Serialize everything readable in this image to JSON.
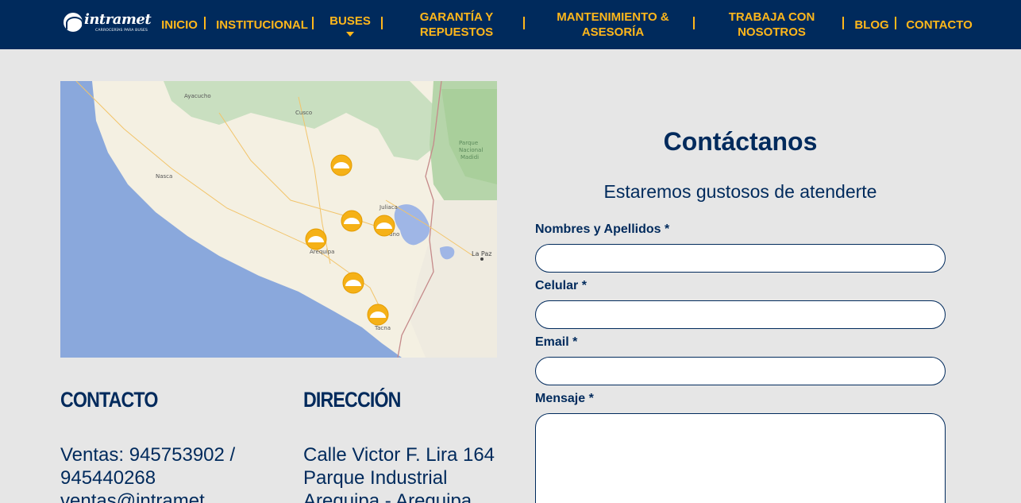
{
  "brand": {
    "name": "intramet",
    "tagline": "CARROCERÍAS PARA BUSES"
  },
  "nav": {
    "items": [
      {
        "label": "INICIO"
      },
      {
        "label": "INSTITUCIONAL"
      },
      {
        "label": "BUSES"
      },
      {
        "label": "GARANTÍA Y REPUESTOS"
      },
      {
        "label": "MANTENIMIENTO & ASESORÍA"
      },
      {
        "label": "TRABAJA CON NOSOTROS"
      },
      {
        "label": "BLOG"
      },
      {
        "label": "CONTACTO"
      }
    ]
  },
  "map": {
    "places": [
      "Ayacucho",
      "Cusco",
      "Nasca",
      "Juliaca",
      "Puno",
      "Arequipa",
      "La Paz",
      "Tacna",
      "Parque Nacional Madidi"
    ],
    "marker_icon": "intramet-logo-marker"
  },
  "contact": {
    "title": "CONTACTO",
    "line1": "Ventas: 945753902 /",
    "line2": "945440268",
    "line3": "ventas@intramet..."
  },
  "address": {
    "title": "DIRECCIÓN",
    "line1": "Calle Victor F. Lira 164",
    "line2": "Parque Industrial",
    "line3": "Arequipa - Arequipa"
  },
  "form": {
    "title": "Contáctanos",
    "subtitle": "Estaremos gustosos de atenderte",
    "name_label": "Nombres y Apellidos *",
    "phone_label": "Celular *",
    "email_label": "Email *",
    "message_label": "Mensaje *"
  },
  "colors": {
    "navy": "#002a5c",
    "accent": "#ffb71b",
    "background": "#e6e6e6"
  }
}
